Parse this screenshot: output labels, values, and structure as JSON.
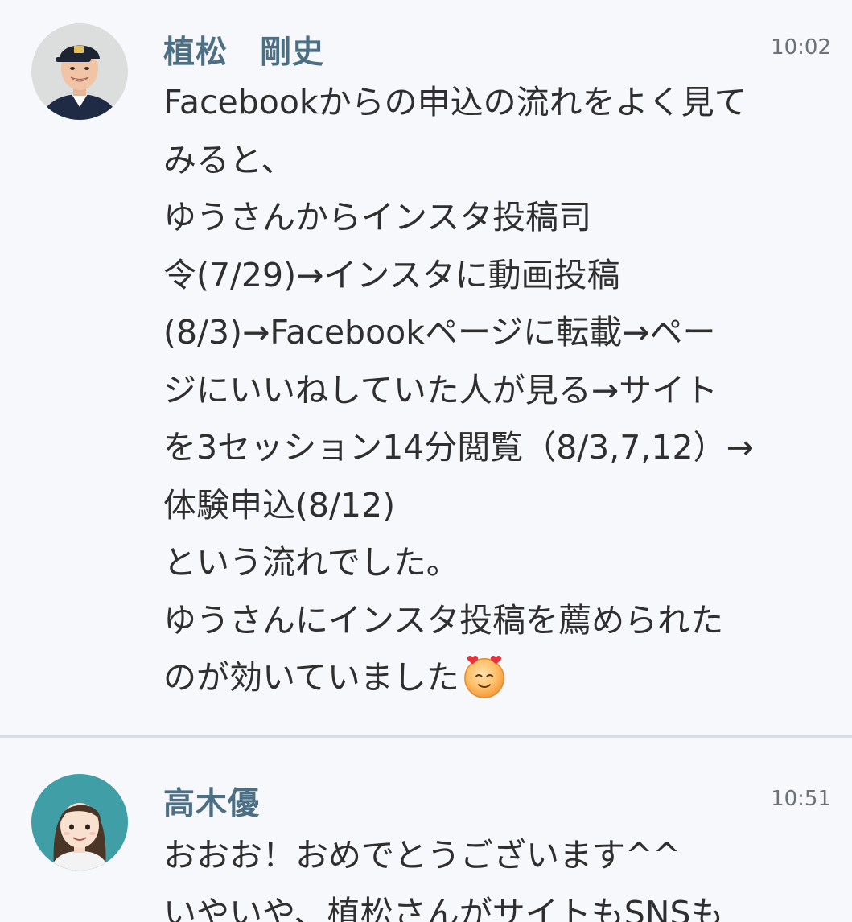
{
  "messages": [
    {
      "sender": "植松　剛史",
      "time": "10:02",
      "avatar": "user-photo-baseball-cap",
      "lines": [
        "Facebookからの申込の流れをよく見て",
        "みると、",
        "ゆうさんからインスタ投稿司",
        "令(7/29)→インスタに動画投稿",
        "(8/3)→Facebookページに転載→ペー",
        "ジにいいねしていた人が見る→サイト",
        "を3セッション14分閲覧（8/3,7,12）→",
        "体験申込(8/12)",
        "という流れでした。",
        "ゆうさんにインスタ投稿を薦められた",
        "のが効いていました"
      ],
      "trailing_emoji": "smiling-face-with-hearts-emoji"
    },
    {
      "sender": "高木優",
      "time": "10:51",
      "avatar": "user-illustration-woman",
      "lines": [
        "おおお！おめでとうございます^^",
        "いやいや、植松さんがサイトもSNSも"
      ]
    }
  ]
}
